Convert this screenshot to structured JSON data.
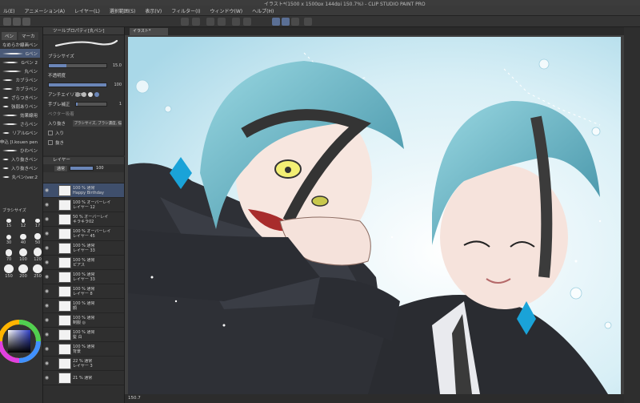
{
  "window": {
    "title": "イラスト*(1500 x 1500px 144dpi 150.7%) - CLIP STUDIO PAINT PRO"
  },
  "menu": [
    "ル(E)",
    "アニメーション(A)",
    "レイヤー(L)",
    "選択範囲(S)",
    "表示(V)",
    "フィルター(I)",
    "ウィンドウ(W)",
    "ヘルプ(H)"
  ],
  "subtools": {
    "tabs": [
      "ペン",
      "マーカ"
    ],
    "items": [
      {
        "label": "なめらか線画ペン"
      },
      {
        "label": "Gペン"
      },
      {
        "label": "Gペン 2"
      },
      {
        "label": "丸ペン"
      },
      {
        "label": "カブラペン"
      },
      {
        "label": "カブラペン"
      },
      {
        "label": "ざらつきペン"
      },
      {
        "label": "強弱ありペン"
      },
      {
        "label": "効果線用"
      },
      {
        "label": "さらペン"
      },
      {
        "label": "リアルGペン"
      },
      {
        "label": "申込 [I.kouen pen"
      },
      {
        "label": "ひわペン"
      },
      {
        "label": "入り抜きペン"
      },
      {
        "label": "入り抜きペン"
      },
      {
        "label": "丸ペン(ver.2"
      }
    ],
    "selected_index": 1
  },
  "brush_sizes": {
    "title": "ブラシサイズ",
    "values": [
      "15",
      "12",
      "17",
      "30",
      "40",
      "50",
      "70",
      "100",
      "120",
      "150",
      "200",
      "250"
    ]
  },
  "tool_property": {
    "header": "ツールプロパティ[丸ペン]",
    "brush_size_label": "ブラシサイズ",
    "brush_size_value": "15.0",
    "brush_size_fill": 0.3,
    "opacity_label": "不透明度",
    "opacity_value": "100",
    "opacity_fill": 1.0,
    "antialias_label": "アンチエイリアス",
    "stabilizer_label": "手ブレ補正",
    "stabilizer_value": "1",
    "stabilizer_fill": 0.05,
    "vector_label": "ベクター吸着",
    "inout_label": "入り抜き",
    "inout_value": "ブラシサイズ, ブラシ濃度, 描画",
    "in_label": "入り",
    "out_label": "抜き"
  },
  "layers": {
    "header": "レイヤー",
    "blend_mode": "通常",
    "opacity_value": "100",
    "items": [
      {
        "blend": "100 % 通常",
        "name": "Happy Birthday"
      },
      {
        "blend": "100 % オーバーレイ",
        "name": "レイヤー 12"
      },
      {
        "blend": "50 % オーバーレイ",
        "name": "キラキラ02"
      },
      {
        "blend": "100 % オーバーレイ",
        "name": "レイヤー 45"
      },
      {
        "blend": "100 % 通常",
        "name": "レイヤー 33"
      },
      {
        "blend": "100 % 通常",
        "name": "ピアス"
      },
      {
        "blend": "100 % 通常",
        "name": "レイヤー 33"
      },
      {
        "blend": "100 % 通常",
        "name": "レイヤー 8"
      },
      {
        "blend": "100 % 通常",
        "name": "顔"
      },
      {
        "blend": "100 % 通常",
        "name": "制服 ◎"
      },
      {
        "blend": "100 % 通常",
        "name": "髪 白"
      },
      {
        "blend": "100 % 通常",
        "name": "背景"
      },
      {
        "blend": "22 % 通常",
        "name": "レイヤー 3"
      },
      {
        "blend": "21 % 通常",
        "name": ""
      }
    ],
    "selected_index": 0
  },
  "canvas": {
    "tab_label": "イラスト*",
    "zoom": "150.7"
  },
  "colors": {
    "accent": "#4a5a78",
    "hair": "#5fb3c4",
    "background_sky": "#bfe3ef"
  }
}
